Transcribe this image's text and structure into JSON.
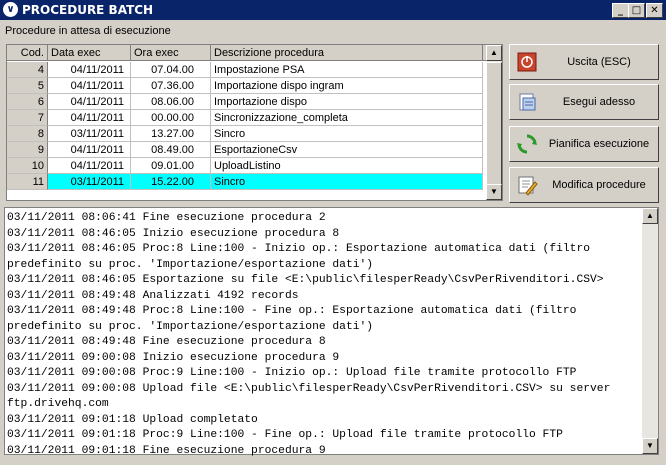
{
  "window": {
    "title": "PROCEDURE BATCH"
  },
  "subtitle": "Procedure in attesa di esecuzione",
  "grid": {
    "headers": [
      "Cod.",
      "Data exec",
      "Ora exec",
      "Descrizione procedura"
    ],
    "rows": [
      [
        "4",
        "04/11/2011",
        "07.04.00",
        "Impostazione PSA"
      ],
      [
        "5",
        "04/11/2011",
        "07.36.00",
        "Importazione dispo ingram"
      ],
      [
        "6",
        "04/11/2011",
        "08.06.00",
        "Importazione dispo"
      ],
      [
        "7",
        "04/11/2011",
        "00.00.00",
        "Sincronizzazione_completa"
      ],
      [
        "8",
        "03/11/2011",
        "13.27.00",
        "Sincro"
      ],
      [
        "9",
        "04/11/2011",
        "08.49.00",
        "EsportazioneCsv"
      ],
      [
        "10",
        "04/11/2011",
        "09.01.00",
        "UploadListino"
      ],
      [
        "11",
        "03/11/2011",
        "15.22.00",
        "Sincro"
      ]
    ],
    "selected_row": "11"
  },
  "buttons": {
    "exit": "Uscita (ESC)",
    "run_now": "Esegui adesso",
    "schedule": "Pianifica esecuzione",
    "edit": "Modifica procedure"
  },
  "log_text": "03/11/2011 08:06:41 Fine esecuzione procedura 2\n03/11/2011 08:46:05 Inizio esecuzione procedura 8\n03/11/2011 08:46:05 Proc:8 Line:100 - Inizio op.: Esportazione automatica dati (filtro predefinito su proc. 'Importazione/esportazione dati')\n03/11/2011 08:46:05 Esportazione su file <E:\\public\\filesperReady\\CsvPerRivenditori.CSV>\n03/11/2011 08:49:48 Analizzati 4192 records\n03/11/2011 08:49:48 Proc:8 Line:100 - Fine op.: Esportazione automatica dati (filtro predefinito su proc. 'Importazione/esportazione dati')\n03/11/2011 08:49:48 Fine esecuzione procedura 8\n03/11/2011 09:00:08 Inizio esecuzione procedura 9\n03/11/2011 09:00:08 Proc:9 Line:100 - Inizio op.: Upload file tramite protocollo FTP\n03/11/2011 09:00:08 Upload file <E:\\public\\filesperReady\\CsvPerRivenditori.CSV> su server ftp.drivehq.com\n03/11/2011 09:01:18 Upload completato\n03/11/2011 09:01:18 Proc:9 Line:100 - Fine op.: Upload file tramite protocollo FTP\n03/11/2011 09:01:18 Fine esecuzione procedura 9",
  "colors": {
    "titlebar": "#0a246a",
    "selection": "#00ffff",
    "face": "#d4d0c8"
  },
  "icons": [
    "app-icon",
    "minimize-icon",
    "maximize-icon",
    "close-icon",
    "exit-icon",
    "run-icon",
    "schedule-icon",
    "edit-icon",
    "scroll-up-icon",
    "scroll-down-icon"
  ]
}
